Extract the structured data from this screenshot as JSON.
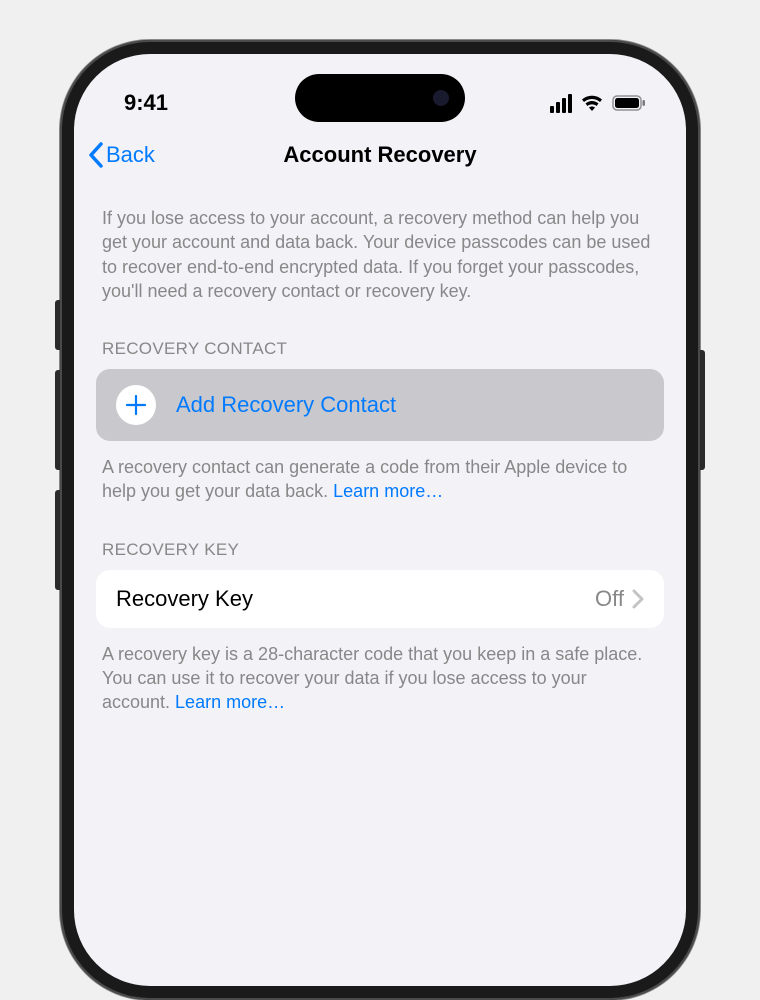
{
  "statusBar": {
    "time": "9:41"
  },
  "nav": {
    "back": "Back",
    "title": "Account Recovery"
  },
  "intro": "If you lose access to your account, a recovery method can help you get your account and data back. Your device passcodes can be used to recover end-to-end encrypted data. If you forget your passcodes, you'll need a recovery contact or recovery key.",
  "sections": {
    "contact": {
      "header": "RECOVERY CONTACT",
      "addLabel": "Add Recovery Contact",
      "footer": "A recovery contact can generate a code from their Apple device to help you get your data back. ",
      "learnMore": "Learn more…"
    },
    "key": {
      "header": "RECOVERY KEY",
      "label": "Recovery Key",
      "value": "Off",
      "footer": "A recovery key is a 28-character code that you keep in a safe place. You can use it to recover your data if you lose access to your account. ",
      "learnMore": "Learn more…"
    }
  }
}
